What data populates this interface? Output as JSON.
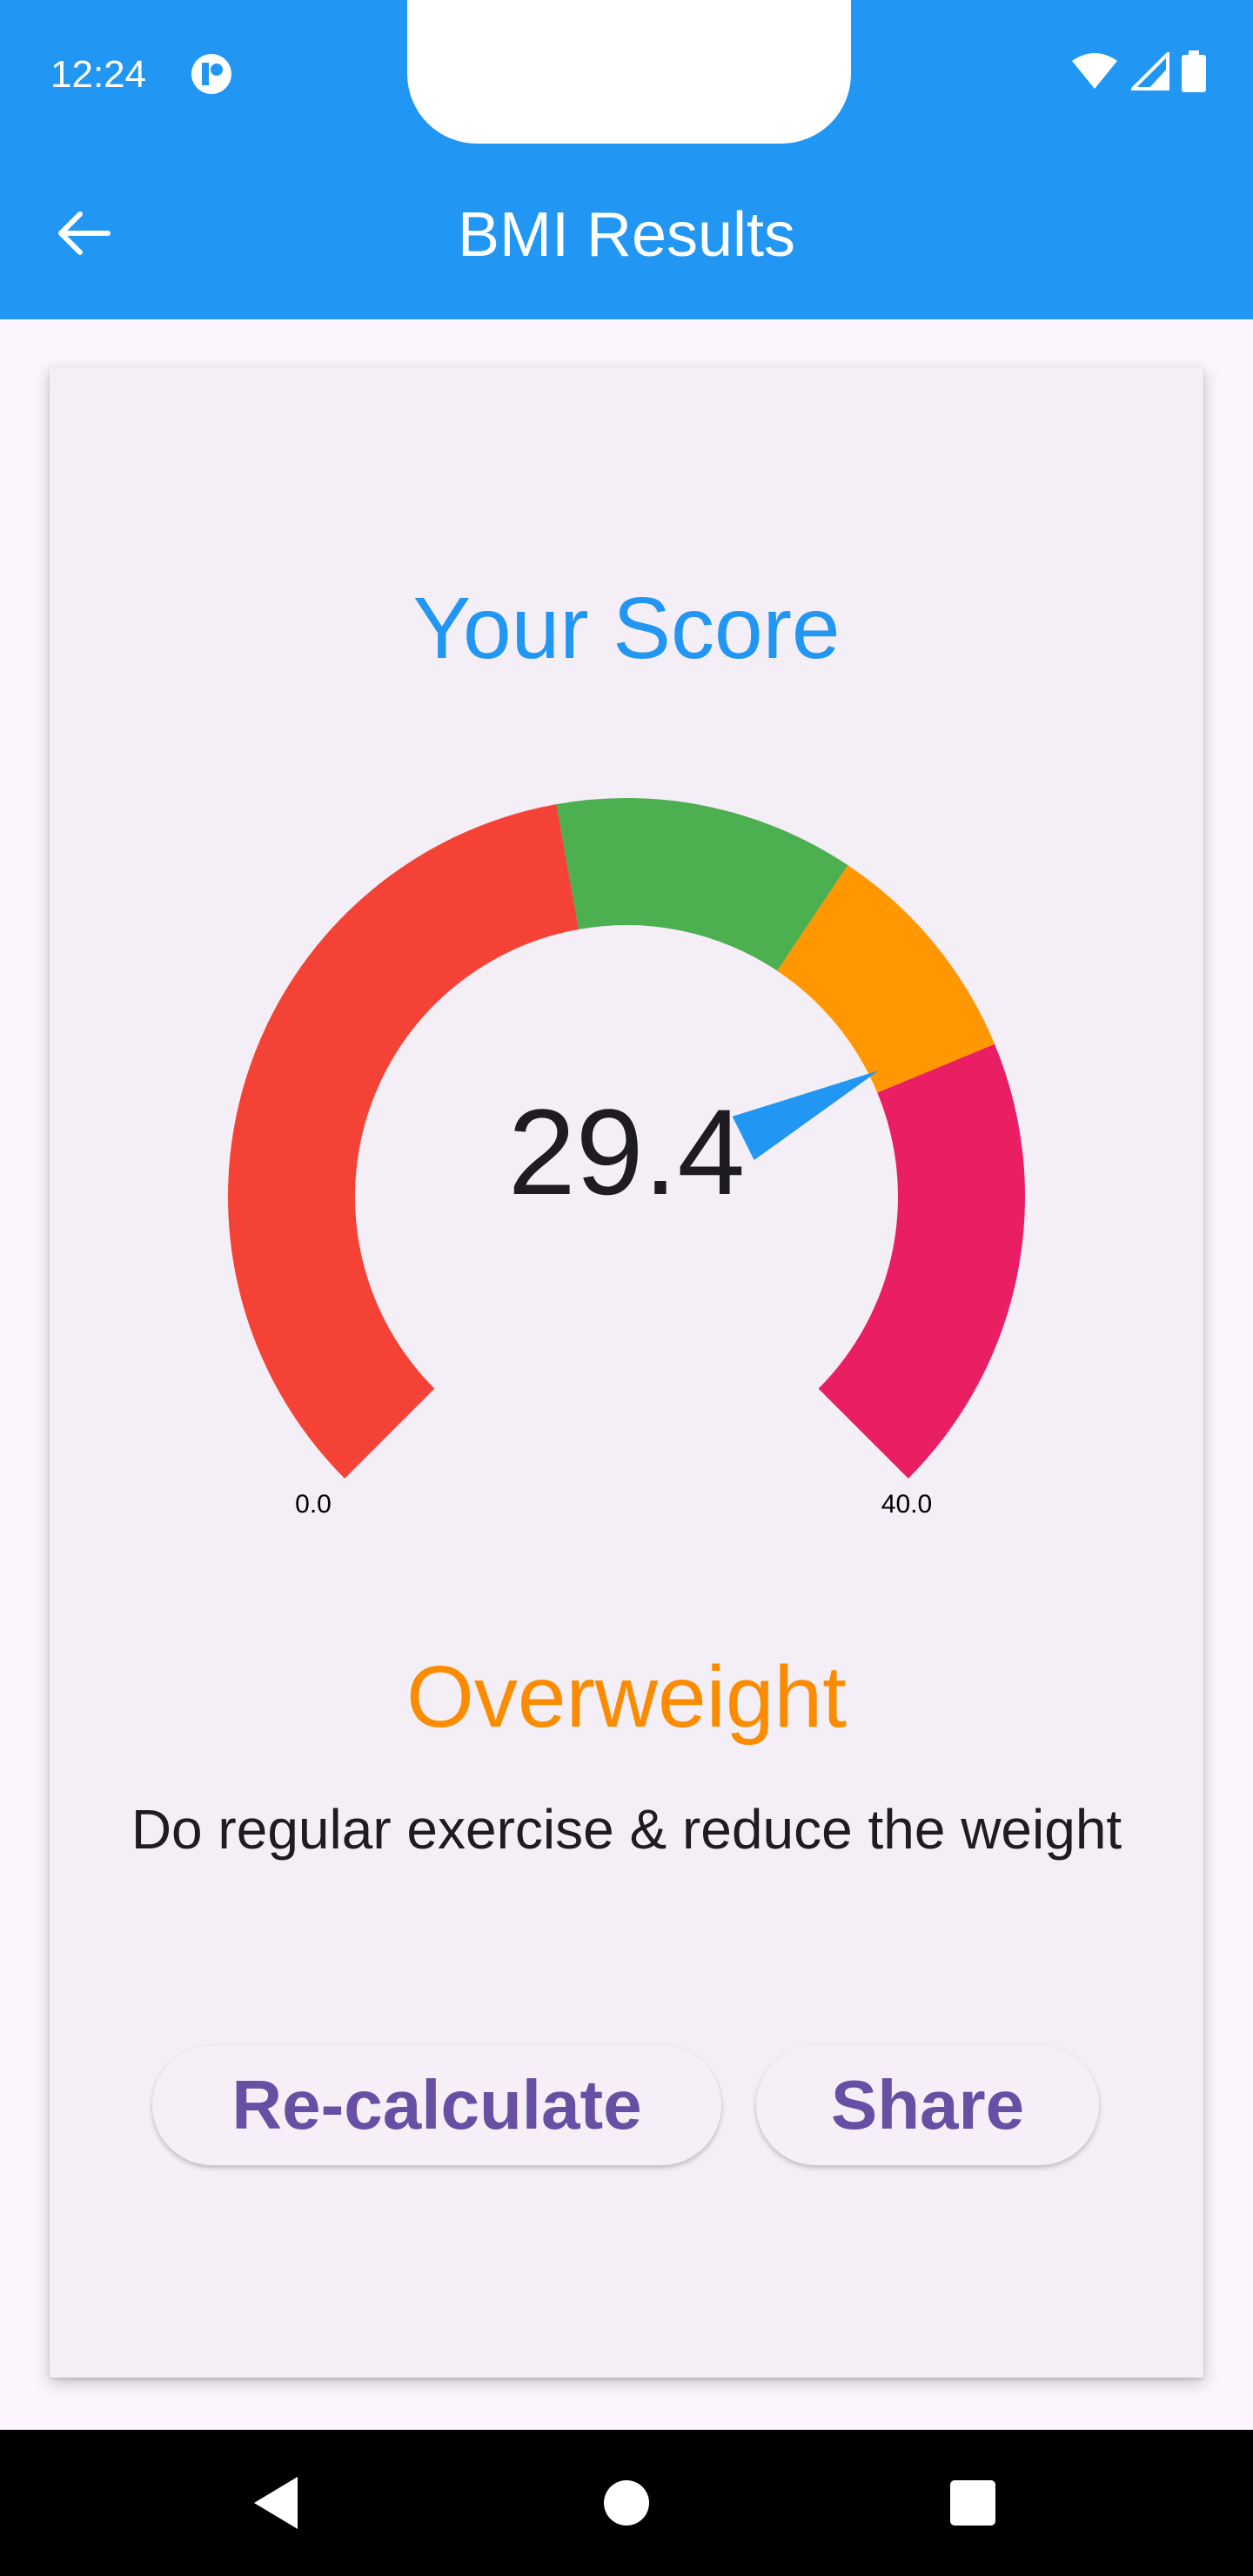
{
  "status_bar": {
    "time": "12:24",
    "icons": [
      "app-notification-icon",
      "wifi-icon",
      "cell-signal-icon",
      "battery-icon"
    ]
  },
  "app_bar": {
    "title": "BMI Results",
    "back_icon": "arrow-left-icon",
    "color": "#2196f3"
  },
  "card": {
    "title": "Your Score",
    "score": "29.4",
    "gauge": {
      "min": 0.0,
      "max": 40.0,
      "min_label": "0.0",
      "max_label": "40.0",
      "value": 29.4,
      "ranges": [
        {
          "from": 0.0,
          "to": 18.5,
          "color": "#f44336"
        },
        {
          "from": 18.5,
          "to": 25.0,
          "color": "#4caf50"
        },
        {
          "from": 25.0,
          "to": 30.0,
          "color": "#ff9800"
        },
        {
          "from": 30.0,
          "to": 40.0,
          "color": "#e91e63"
        }
      ],
      "needle_color": "#2196f3"
    },
    "status": "Overweight",
    "status_color": "#fb8c00",
    "advice": "Do regular exercise & reduce the weight",
    "buttons": {
      "recalculate": "Re-calculate",
      "share": "Share"
    }
  },
  "nav_bar": {
    "icons": [
      "back-triangle-icon",
      "home-circle-icon",
      "recents-square-icon"
    ]
  }
}
